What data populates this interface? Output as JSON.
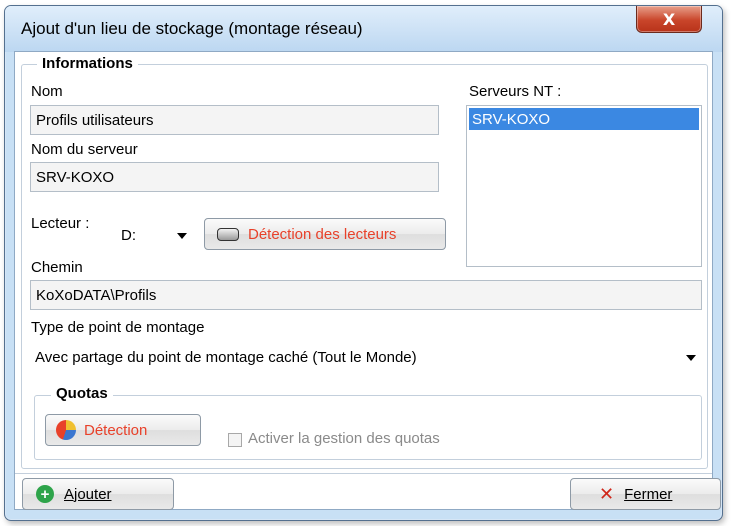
{
  "window": {
    "title": "Ajout d'un lieu de stockage (montage réseau)",
    "close_label": "X"
  },
  "informations": {
    "legend": "Informations",
    "nom_label": "Nom",
    "nom_value": "Profils utilisateurs",
    "serveur_label": "Nom du serveur",
    "serveur_value": "SRV-KOXO",
    "lecteur_label": "Lecteur :",
    "lecteur_value": "D:",
    "detection_lecteurs_label": "Détection des lecteurs",
    "chemin_label": "Chemin",
    "chemin_value": "KoXoDATA\\Profils",
    "serveurs_nt_label": "Serveurs NT :",
    "serveurs_nt_items": [
      "SRV-KOXO"
    ],
    "type_label": "Type de point de montage",
    "type_value": "Avec partage du point de montage caché (Tout le Monde)"
  },
  "quotas": {
    "legend": "Quotas",
    "detection_label": "Détection",
    "activer_label": "Activer la gestion des quotas"
  },
  "footer": {
    "ajouter_label": "Ajouter",
    "fermer_label": "Fermer"
  },
  "colors": {
    "accent_red": "#e8412a",
    "selection": "#3b88e2",
    "title_bg": "#c8e0f5"
  },
  "icons": [
    "close-icon",
    "drive-icon",
    "pie-chart-icon",
    "plus-icon",
    "x-icon",
    "dropdown-arrow-icon"
  ]
}
